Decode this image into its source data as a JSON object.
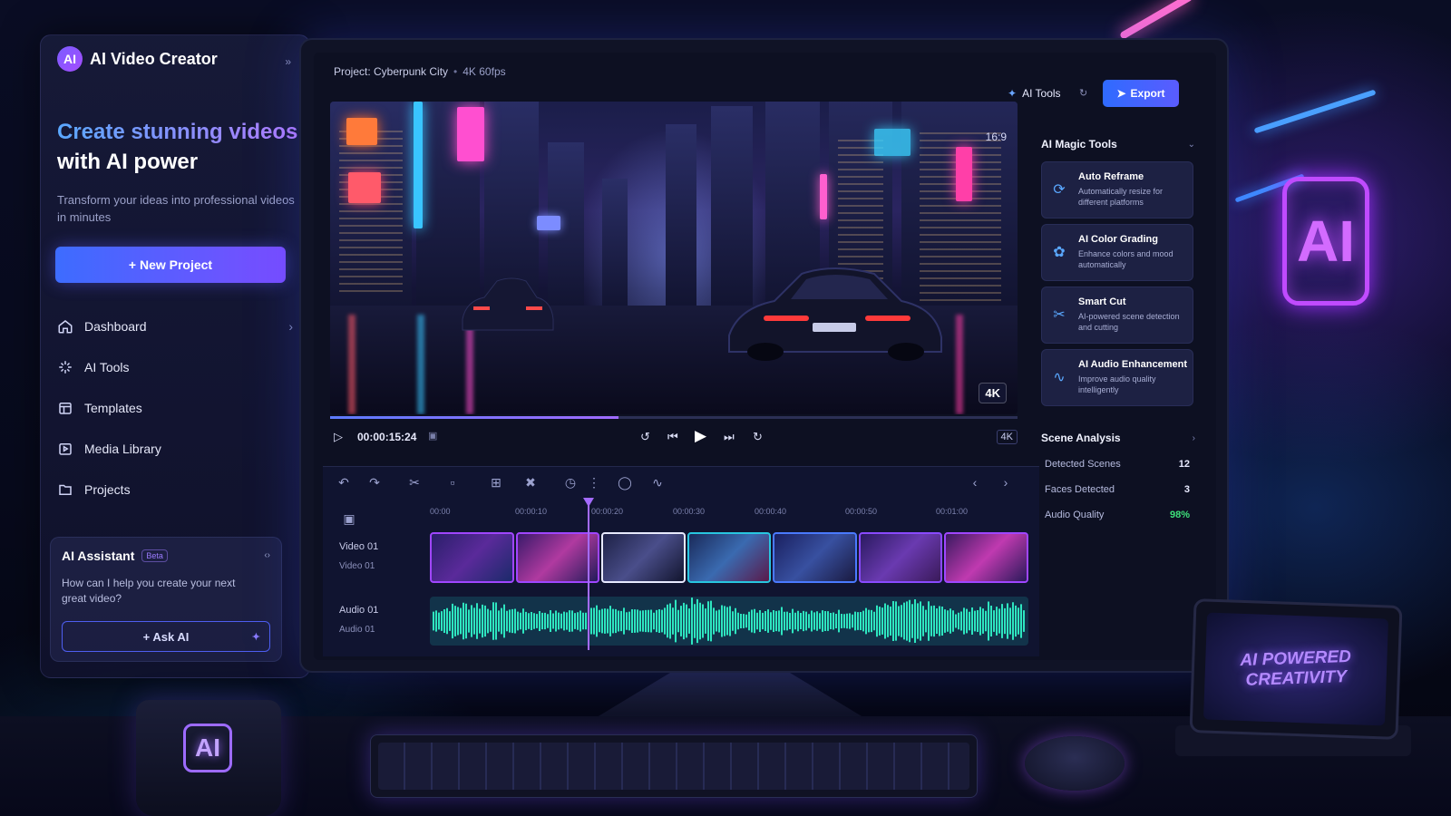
{
  "app": {
    "logo_text": "AI",
    "name": "AI Video Creator",
    "collapse_icon": "chevrons-right-icon"
  },
  "hero": {
    "line1": "Create stunning videos",
    "line2": "with AI power",
    "subtitle": "Transform your ideas into professional videos in minutes"
  },
  "new_project": {
    "label": "+ New Project"
  },
  "nav": {
    "items": [
      {
        "label": "Dashboard",
        "icon": "home-icon",
        "active": true
      },
      {
        "label": "AI Tools",
        "icon": "sparkle-icon"
      },
      {
        "label": "Templates",
        "icon": "template-icon"
      },
      {
        "label": "Media Library",
        "icon": "media-icon"
      },
      {
        "label": "Projects",
        "icon": "folder-icon"
      }
    ]
  },
  "assistant": {
    "title": "AI Assistant",
    "badge": "Beta",
    "question": "How can I help you create your next great video?",
    "button": "+ Ask AI"
  },
  "project": {
    "title": "Project: Cyberpunk City",
    "meta": "4K 60fps"
  },
  "toolbar": {
    "ai_tools": "AI Tools",
    "export": "Export"
  },
  "preview": {
    "aspect": "16:9",
    "quality": "4K",
    "progress": 0.42
  },
  "playback": {
    "timecode": "00:00:15:24",
    "resolution": "4K"
  },
  "timeline": {
    "ruler": [
      "00:00",
      "00:00:10",
      "00:00:20",
      "00:00:30",
      "00:00:40",
      "00:00:50",
      "00:01:00"
    ],
    "video_track": {
      "label": "Video 01",
      "sub": "Video 01"
    },
    "audio_track": {
      "label": "Audio 01",
      "sub": "Audio 01"
    }
  },
  "magic_tools": {
    "title": "AI Magic Tools",
    "items": [
      {
        "name": "Auto Reframe",
        "desc": "Automatically resize for different platforms",
        "icon": "reframe-icon"
      },
      {
        "name": "AI Color Grading",
        "desc": "Enhance colors and mood automatically",
        "icon": "palette-icon"
      },
      {
        "name": "Smart Cut",
        "desc": "AI-powered scene detection and cutting",
        "icon": "scissors-icon"
      },
      {
        "name": "AI Audio Enhancement",
        "desc": "Improve audio quality intelligently",
        "icon": "waveform-icon"
      }
    ]
  },
  "scene_analysis": {
    "title": "Scene Analysis",
    "stats": [
      {
        "label": "Detected Scenes",
        "value": "12"
      },
      {
        "label": "Faces Detected",
        "value": "3"
      },
      {
        "label": "Audio Quality",
        "value": "98%"
      }
    ]
  },
  "decor": {
    "neon_sign": "AI",
    "mug_logo": "AI",
    "tablet_text": "AI POWERED CREATIVITY"
  },
  "colors": {
    "accent": "#5a5cff",
    "purple": "#a46bff",
    "audio": "#2ee6c0",
    "quality_good": "#3ee07a"
  }
}
